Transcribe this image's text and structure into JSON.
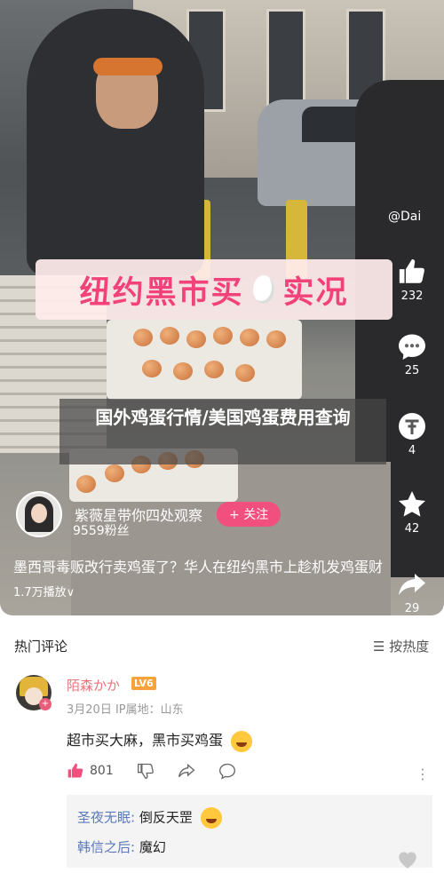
{
  "video": {
    "banner_left": "纽约黑市买",
    "banner_right": "实况",
    "overlay_title": "国外鸡蛋行情/美国鸡蛋费用查询",
    "watermark": "@Dai",
    "author_name": "紫薇星带你四处观察",
    "follow_label": "+ 关注",
    "fans": "9559粉丝",
    "description": "墨西哥毒贩改行卖鸡蛋了？华人在纽约黑市上趁机发鸡蛋财",
    "plays": "1.7万播放∨"
  },
  "rail": {
    "likes": "232",
    "comments": "25",
    "coins": "4",
    "favorites": "42",
    "shares": "29"
  },
  "comments_section": {
    "hot_label": "热门评论",
    "sort_label": "按热度",
    "comment": {
      "user": "陌森かか",
      "level": "LV6",
      "meta": "3月20日 IP属地：山东",
      "text": "超市买大麻，黑市买鸡蛋",
      "likes": "801"
    },
    "replies": [
      {
        "name": "圣夜无眠:",
        "text": "倒反天罡"
      },
      {
        "name": "韩信之后:",
        "text": "魔幻"
      }
    ]
  },
  "colors": {
    "accent_pink": "#f14f7d",
    "username": "#e8747b",
    "reply_name": "#5b78b8"
  },
  "icons": [
    "thumb-up-icon",
    "comment-icon",
    "coin-icon",
    "star-icon",
    "share-icon",
    "heart-icon",
    "sort-icon",
    "thumb-down-icon",
    "forward-icon",
    "reply-icon",
    "more-icon"
  ]
}
